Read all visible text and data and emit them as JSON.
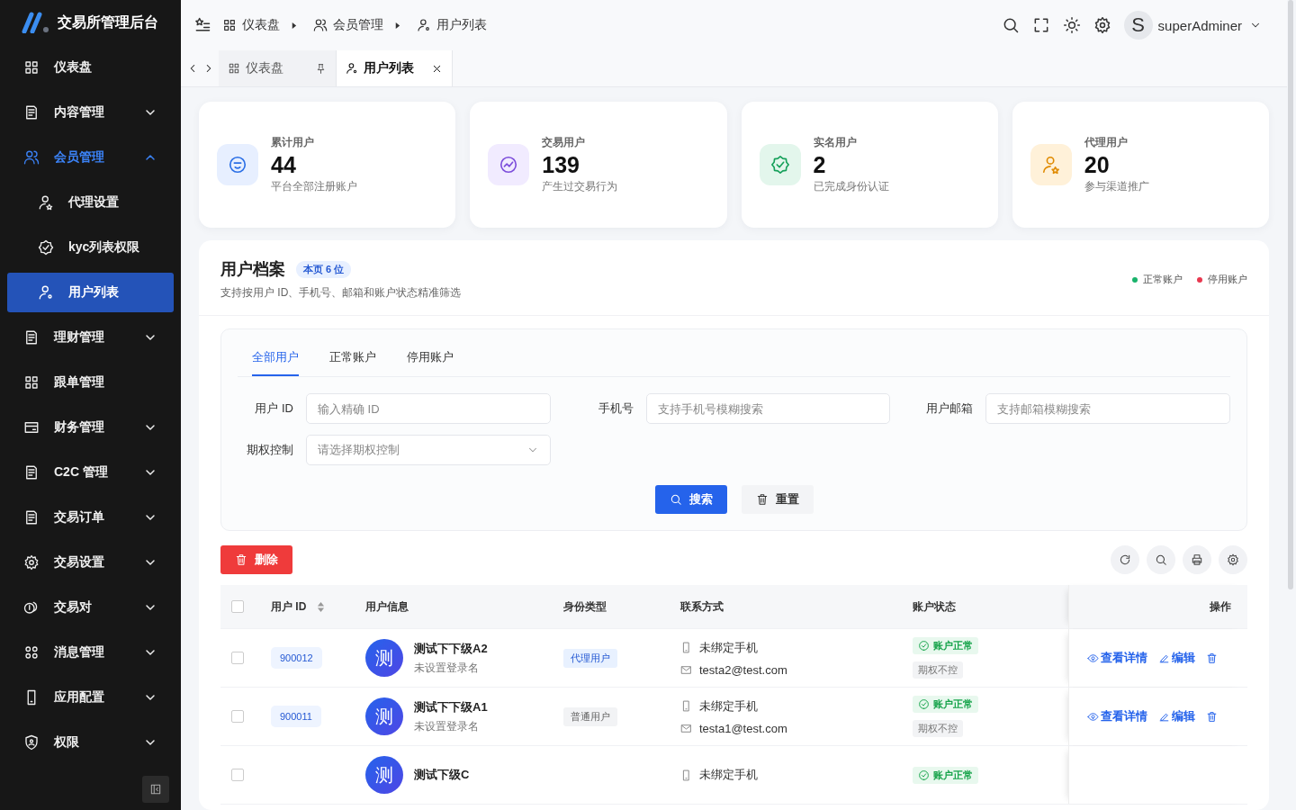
{
  "brand": {
    "name": "交易所管理后台"
  },
  "sidebar": {
    "items": [
      {
        "label": "仪表盘",
        "selected": false
      },
      {
        "label": "内容管理",
        "selected": false,
        "expanded": false
      },
      {
        "label": "会员管理",
        "selected": false,
        "expanded": true,
        "children": [
          {
            "label": "代理设置",
            "selected": false
          },
          {
            "label": "kyc列表权限",
            "selected": false
          },
          {
            "label": "用户列表",
            "selected": true
          }
        ]
      },
      {
        "label": "理财管理",
        "selected": false,
        "expanded": false
      },
      {
        "label": "跟单管理",
        "selected": false
      },
      {
        "label": "财务管理",
        "selected": false,
        "expanded": false
      },
      {
        "label": "C2C 管理",
        "selected": false,
        "expanded": false
      },
      {
        "label": "交易订单",
        "selected": false,
        "expanded": false
      },
      {
        "label": "交易设置",
        "selected": false,
        "expanded": false
      },
      {
        "label": "交易对",
        "selected": false,
        "expanded": false
      },
      {
        "label": "消息管理",
        "selected": false,
        "expanded": false
      },
      {
        "label": "应用配置",
        "selected": false,
        "expanded": false
      },
      {
        "label": "权限",
        "selected": false,
        "expanded": false
      }
    ]
  },
  "breadcrumb": [
    "仪表盘",
    "会员管理",
    "用户列表"
  ],
  "user": {
    "avatar": "S",
    "name": "superAdminer"
  },
  "tabs": [
    {
      "label": "仪表盘",
      "selected": false,
      "pinned": true
    },
    {
      "label": "用户列表",
      "selected": true,
      "pinned": false
    }
  ],
  "stats": [
    {
      "label": "累计用户",
      "value": "44",
      "note": "平台全部注册账户"
    },
    {
      "label": "交易用户",
      "value": "139",
      "note": "产生过交易行为"
    },
    {
      "label": "实名用户",
      "value": "2",
      "note": "已完成身份认证"
    },
    {
      "label": "代理用户",
      "value": "20",
      "note": "参与渠道推广"
    }
  ],
  "panel": {
    "title": "用户档案",
    "badge": "本页 6 位",
    "subtitle": "支持按用户 ID、手机号、邮箱和账户状态精准筛选",
    "legend": [
      {
        "label": "正常账户",
        "color": "#19b36b"
      },
      {
        "label": "停用账户",
        "color": "#e8384f"
      }
    ]
  },
  "filter_tabs": [
    {
      "label": "全部用户",
      "selected": true
    },
    {
      "label": "正常账户",
      "selected": false
    },
    {
      "label": "停用账户",
      "selected": false
    }
  ],
  "fields": [
    {
      "label": "用户 ID",
      "kind": "input",
      "placeholder": "输入精确 ID"
    },
    {
      "label": "手机号",
      "kind": "input",
      "placeholder": "支持手机号模糊搜索"
    },
    {
      "label": "用户邮箱",
      "kind": "input",
      "placeholder": "支持邮箱模糊搜索"
    },
    {
      "label": "期权控制",
      "kind": "select",
      "placeholder": "请选择期权控制"
    }
  ],
  "buttons": {
    "search": "搜索",
    "reset": "重置",
    "delete": "删除"
  },
  "table": {
    "select_all": {
      "checked": false
    },
    "columns": [
      "用户 ID",
      "用户信息",
      "身份类型",
      "联系方式",
      "账户状态",
      "操作"
    ],
    "rows": [
      {
        "checked": false,
        "id": "900012",
        "avatar": "测",
        "name": "测试下下级A2",
        "login": "未设置登录名",
        "role": {
          "label": "代理用户",
          "color": "#e8f1ff"
        },
        "phone": "未绑定手机",
        "email": "testa2@test.com",
        "status": "账户正常",
        "control": "期权不控",
        "actions": [
          "查看详情",
          "编辑"
        ]
      },
      {
        "checked": false,
        "id": "900011",
        "avatar": "测",
        "name": "测试下下级A1",
        "login": "未设置登录名",
        "role": {
          "label": "普通用户",
          "color": "#f2f3f5"
        },
        "phone": "未绑定手机",
        "email": "testa1@test.com",
        "status": "账户正常",
        "control": "期权不控",
        "actions": [
          "查看详情",
          "编辑"
        ]
      },
      {
        "checked": false,
        "avatar": "测",
        "name": "测试下级C",
        "phone": "未绑定手机",
        "status": "账户正常"
      }
    ]
  }
}
